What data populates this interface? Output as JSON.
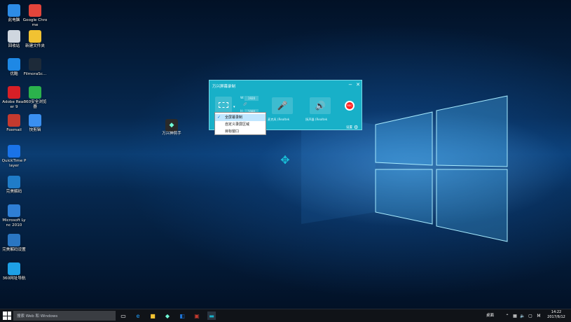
{
  "desktop": {
    "icons": [
      {
        "label": "此电脑",
        "icon": "computer-icon",
        "color": "#2d8ce6"
      },
      {
        "label": "Google Chrome",
        "icon": "chrome-icon",
        "color": "#e3453b"
      },
      {
        "label": "回收站",
        "icon": "recycle-bin-icon",
        "color": "#cfd6df"
      },
      {
        "label": "新建文件夹",
        "icon": "folder-icon",
        "color": "#f1c232"
      },
      {
        "label": "优酷",
        "icon": "youku-icon",
        "color": "#1e88e5"
      },
      {
        "label": "FilmoraSc...",
        "icon": "filmora-icon",
        "color": "#1d2a39"
      },
      {
        "label": "Adobe Reader 9",
        "icon": "adobe-reader-icon",
        "color": "#d71f26"
      },
      {
        "label": "360安全浏览器",
        "icon": "browser-360-icon",
        "color": "#2bb24c"
      },
      {
        "label": "Foxmail",
        "icon": "foxmail-icon",
        "color": "#c43a2f"
      },
      {
        "label": "快剪辑",
        "icon": "kuaijianji-icon",
        "color": "#3a8ff0"
      },
      {
        "label": "QuickTime Player",
        "icon": "quicktime-icon",
        "color": "#1a73e8"
      },
      {
        "label": "完美解码",
        "icon": "perfect-decoder-icon",
        "color": "#1f7cc8"
      },
      {
        "label": "Microsoft Lync 2010",
        "icon": "lync-icon",
        "color": "#2f7fd5"
      },
      {
        "label": "完美解码设置",
        "icon": "decoder-settings-icon",
        "color": "#2a76c2"
      },
      {
        "label": "360网址导航",
        "icon": "ie-icon",
        "color": "#1ea0e6"
      }
    ],
    "app_shortcut": {
      "label": "万兴神剪手",
      "icon": "wanxing-editor-icon"
    }
  },
  "recorder": {
    "title": "万兴屏幕录制",
    "minimize": "−",
    "close": "✕",
    "width_label": "W:",
    "width_value": "1920",
    "height_label": "H:",
    "height_value": "1080",
    "mic_label": "麦克风 (Realtek",
    "speaker_label": "扬声器 (Realtek",
    "rec_label": "REC",
    "settings_label": "设置"
  },
  "dropdown": {
    "items": [
      {
        "label": "全屏幕录制",
        "selected": true
      },
      {
        "label": "自定义录屏区域",
        "selected": false
      },
      {
        "label": "目标窗口",
        "selected": false
      }
    ],
    "check": "✓"
  },
  "taskbar": {
    "search_placeholder": "搜索 Web 和 Windows",
    "tray_label": "桌面",
    "ime": "M",
    "time": "14:22",
    "date": "2017/6/12"
  }
}
